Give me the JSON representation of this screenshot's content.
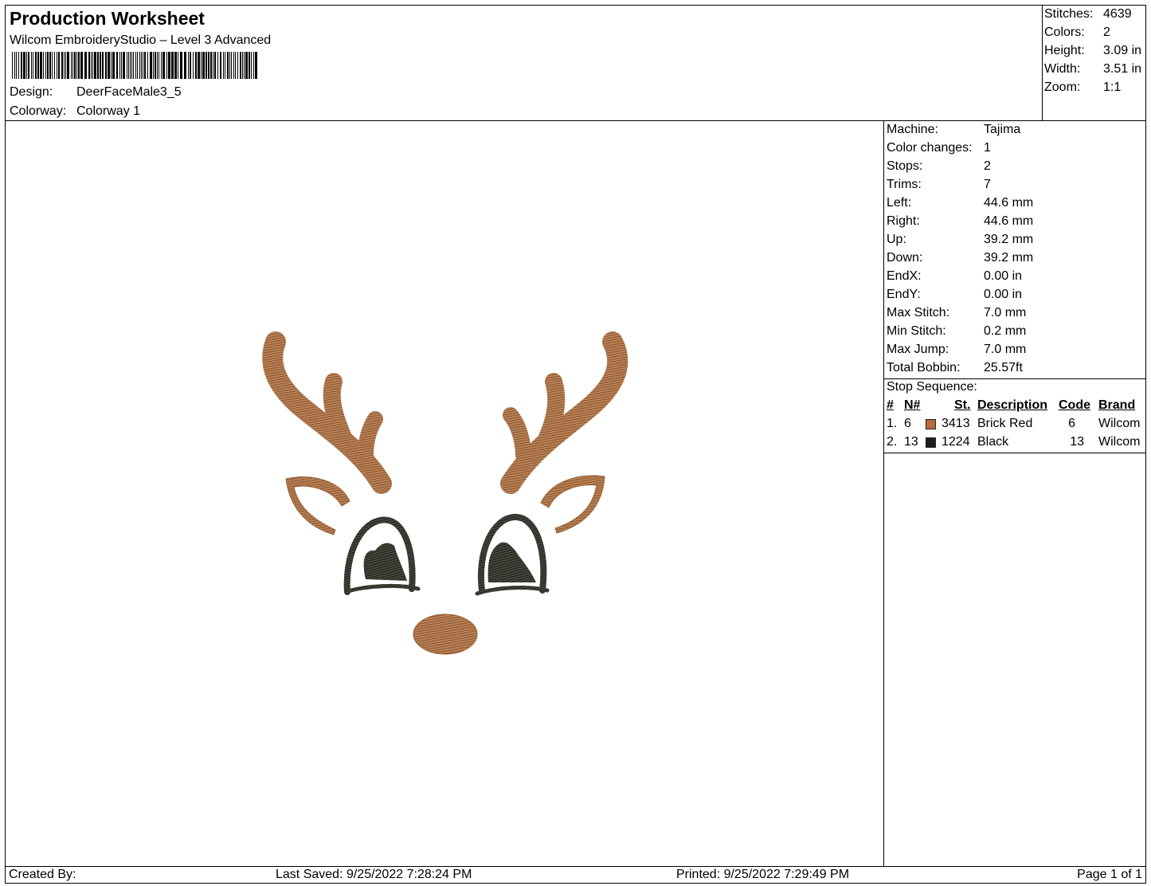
{
  "header": {
    "title": "Production Worksheet",
    "subtitle": "Wilcom EmbroideryStudio – Level 3 Advanced",
    "design_label": "Design:",
    "design_value": "DeerFaceMale3_5",
    "colorway_label": "Colorway:",
    "colorway_value": "Colorway 1"
  },
  "stats": [
    {
      "label": "Stitches:",
      "value": "4639"
    },
    {
      "label": "Colors:",
      "value": "2"
    },
    {
      "label": "Height:",
      "value": "3.09 in"
    },
    {
      "label": "Width:",
      "value": "3.51 in"
    },
    {
      "label": "Zoom:",
      "value": "1:1"
    }
  ],
  "machine_info": [
    {
      "label": "Machine:",
      "value": "Tajima"
    },
    {
      "label": "Color changes:",
      "value": "1"
    },
    {
      "label": "Stops:",
      "value": "2"
    },
    {
      "label": "Trims:",
      "value": "7"
    },
    {
      "label": "Left:",
      "value": "44.6 mm"
    },
    {
      "label": "Right:",
      "value": "44.6 mm"
    },
    {
      "label": "Up:",
      "value": "39.2 mm"
    },
    {
      "label": "Down:",
      "value": "39.2 mm"
    },
    {
      "label": "EndX:",
      "value": "0.00 in"
    },
    {
      "label": "EndY:",
      "value": "0.00 in"
    },
    {
      "label": "Max Stitch:",
      "value": "7.0 mm"
    },
    {
      "label": "Min Stitch:",
      "value": "0.2 mm"
    },
    {
      "label": "Max Jump:",
      "value": "7.0 mm"
    },
    {
      "label": "Total Bobbin:",
      "value": "25.57ft"
    }
  ],
  "stop_sequence": {
    "title": "Stop Sequence:",
    "headers": {
      "num": "#",
      "n": "N#",
      "st": "St.",
      "description": "Description",
      "code": "Code",
      "brand": "Brand"
    },
    "rows": [
      {
        "num": "1.",
        "n": "6",
        "color": "#b86a3c",
        "st": "3413",
        "description": "Brick Red",
        "code": "6",
        "brand": "Wilcom"
      },
      {
        "num": "2.",
        "n": "13",
        "color": "#1e1e1e",
        "st": "1224",
        "description": "Black",
        "code": "13",
        "brand": "Wilcom"
      }
    ]
  },
  "footer": {
    "created_by": "Created By:",
    "last_saved": "Last Saved: 9/25/2022 7:28:24 PM",
    "printed": "Printed: 9/25/2022 7:29:49 PM",
    "page": "Page 1 of 1"
  },
  "colors": {
    "thread_brown": "#b87a4b",
    "thread_dark": "#3a3830"
  }
}
